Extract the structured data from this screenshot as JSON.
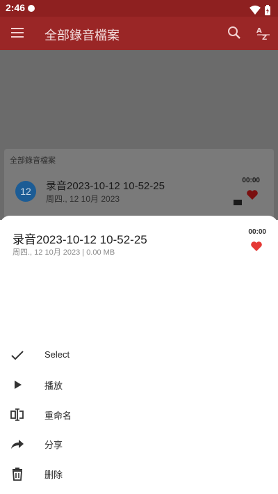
{
  "status_bar": {
    "time": "2:46"
  },
  "app_bar": {
    "title": "全部錄音檔案",
    "menu_icon": "menu-icon",
    "search_icon": "search-icon",
    "sort_icon": "sort-az-icon"
  },
  "list": {
    "section_label": "全部錄音檔案",
    "items": [
      {
        "avatar": "12",
        "name": "录音2023-10-12 10-52-25",
        "date": "周四., 12 10月 2023",
        "duration": "00:00",
        "favorite": true
      }
    ]
  },
  "sheet": {
    "title": "录音2023-10-12 10-52-25",
    "meta": "周四., 12 10月 2023 | 0.00 MB",
    "duration": "00:00",
    "favorite_color": "#e53935",
    "actions": [
      {
        "label": "Select",
        "icon": "check-icon"
      },
      {
        "label": "播放",
        "icon": "play-icon"
      },
      {
        "label": "重命名",
        "icon": "rename-icon"
      },
      {
        "label": "分享",
        "icon": "share-icon"
      },
      {
        "label": "删除",
        "icon": "delete-icon"
      }
    ]
  },
  "colors": {
    "primary": "#9a2626",
    "status_bar": "#8e2020",
    "scrim": "#6b6b6b"
  }
}
